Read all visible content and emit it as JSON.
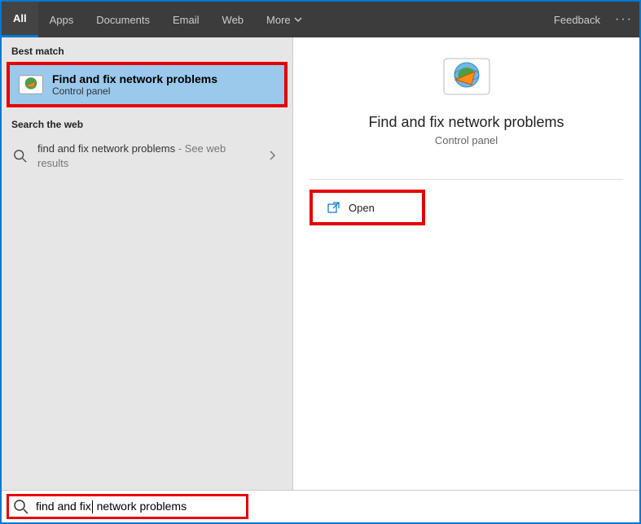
{
  "topbar": {
    "tabs": [
      {
        "label": "All",
        "active": true
      },
      {
        "label": "Apps"
      },
      {
        "label": "Documents"
      },
      {
        "label": "Email"
      },
      {
        "label": "Web"
      },
      {
        "label": "More"
      }
    ],
    "feedback": "Feedback"
  },
  "left": {
    "best_match_label": "Best match",
    "best_match": {
      "title": "Find and fix network problems",
      "sub": "Control panel"
    },
    "search_web_label": "Search the web",
    "web_result": {
      "query": "find and fix network problems",
      "suffix": " - See web results"
    }
  },
  "detail": {
    "title": "Find and fix network problems",
    "sub": "Control panel",
    "open_label": "Open"
  },
  "search": {
    "value_before": "find and fix",
    "value_after": " network problems"
  }
}
